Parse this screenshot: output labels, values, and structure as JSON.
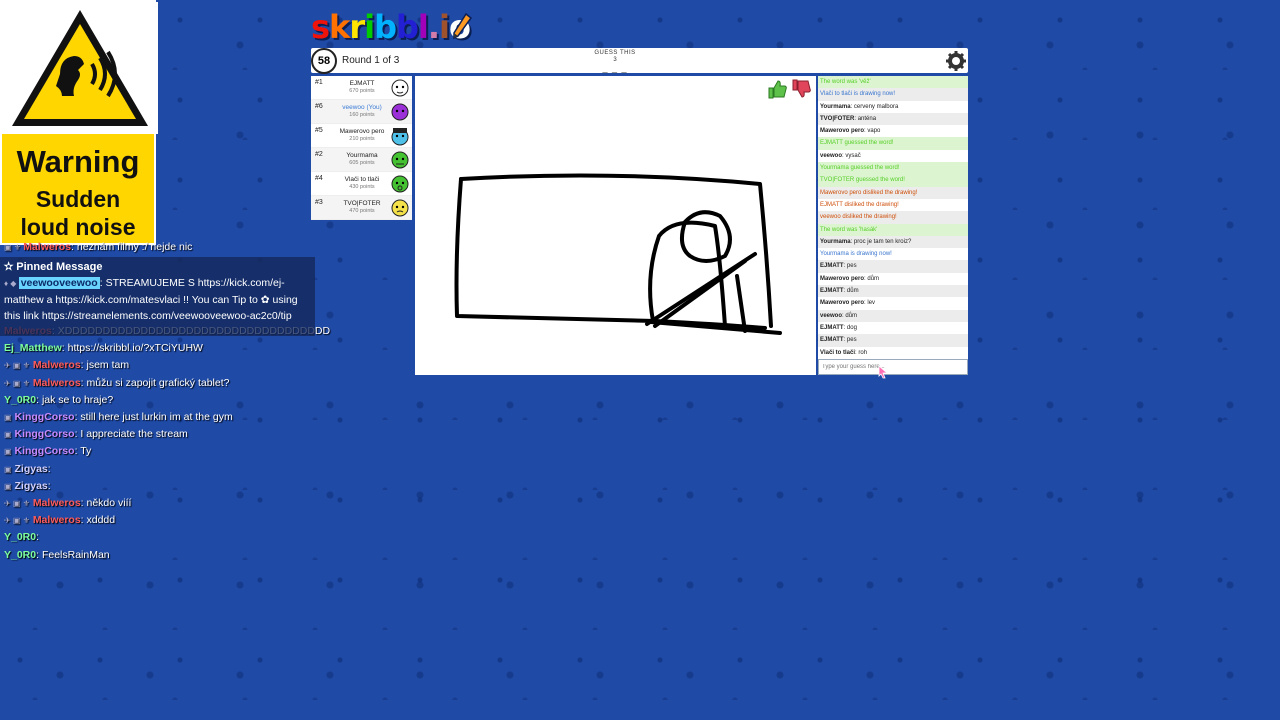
{
  "warning": {
    "title": "Warning",
    "subtitle_1": "Sudden",
    "subtitle_2": "loud noise"
  },
  "game": {
    "logo": "skribbl.io",
    "timer": "58",
    "round": "Round 1 of 3",
    "guess_label": "GUESS THIS",
    "guess_count": "3",
    "guess_blanks": "_ _ _",
    "input_placeholder": "Type your guess here..."
  },
  "players": [
    {
      "rank": "#1",
      "name": "EJMATT",
      "points": "670 points",
      "avatar_color": "#ffffff"
    },
    {
      "rank": "#6",
      "name": "veewoo (You)",
      "points": "160 points",
      "avatar_color": "#9b30d9"
    },
    {
      "rank": "#5",
      "name": "Mawerovo pero",
      "points": "210 points",
      "avatar_color": "#4fc0e8"
    },
    {
      "rank": "#2",
      "name": "Yourmama",
      "points": "605 points",
      "avatar_color": "#45c232"
    },
    {
      "rank": "#4",
      "name": "Vlači to tlači",
      "points": "430 points",
      "avatar_color": "#45c232"
    },
    {
      "rank": "#3",
      "name": "TVO|FOTER",
      "points": "470 points",
      "avatar_color": "#f5e24a"
    }
  ],
  "game_chat": [
    {
      "type": "green",
      "user": "",
      "text": "The word was 'věž'"
    },
    {
      "type": "blue",
      "user": "",
      "text": "Vlači to tlači is drawing now!"
    },
    {
      "type": "normal",
      "user": "Yourmama",
      "text": "cerveny malbora"
    },
    {
      "type": "normal",
      "user": "TVO|FOTER",
      "text": "anténa"
    },
    {
      "type": "normal",
      "user": "Mawerovo pero",
      "text": "vapo"
    },
    {
      "type": "green",
      "user": "",
      "text": "EJMATT guessed the word!"
    },
    {
      "type": "normal",
      "user": "veewoo",
      "text": "vysač"
    },
    {
      "type": "green",
      "user": "",
      "text": "Yourmama guessed the word!"
    },
    {
      "type": "green",
      "user": "",
      "text": "TVO|FOTER guessed the word!"
    },
    {
      "type": "red",
      "user": "",
      "text": "Mawerovo pero disliked the drawing!"
    },
    {
      "type": "red",
      "user": "",
      "text": "EJMATT disliked the drawing!"
    },
    {
      "type": "red",
      "user": "",
      "text": "veewoo disliked the drawing!"
    },
    {
      "type": "green",
      "user": "",
      "text": "The word was 'hasák'"
    },
    {
      "type": "normal",
      "user": "Yourmama",
      "text": "proc je tam ten kroiz?"
    },
    {
      "type": "blue",
      "user": "",
      "text": "Yourmama is drawing now!"
    },
    {
      "type": "normal",
      "user": "EJMATT",
      "text": "pes"
    },
    {
      "type": "normal",
      "user": "Mawerovo pero",
      "text": "dům"
    },
    {
      "type": "normal",
      "user": "EJMATT",
      "text": "dům"
    },
    {
      "type": "normal",
      "user": "Mawerovo pero",
      "text": "lev"
    },
    {
      "type": "normal",
      "user": "veewoo",
      "text": "dům"
    },
    {
      "type": "normal",
      "user": "EJMATT",
      "text": "dog"
    },
    {
      "type": "normal",
      "user": "EJMATT",
      "text": "pes"
    },
    {
      "type": "normal",
      "user": "Vlači to tlači",
      "text": "roh"
    }
  ],
  "stream_chat": {
    "top_partial": {
      "user": "Malweros",
      "text": ": neznám filmy :/ nejde nic"
    },
    "pinned": {
      "header": "Pinned Message",
      "user": "veewooveewoo",
      "line1": "STREAMUJEME S https://kick.com/ej-",
      "line2": "matthew a https://kick.com/matesvlaci !! You can Tip to",
      "line3": "using",
      "line4": "this link https://streamelements.com/veewooveewoo-ac2c0/tip"
    },
    "messages": [
      {
        "user": "Malweros",
        "color": "red",
        "text": ": XDDDDDDDDDDDDDDDDDDDDDDDDDDDDDDDDDDD",
        "icons": ""
      },
      {
        "user": "Ej_Matthew",
        "color": "green",
        "text": ": https://skribbl.io/?xTCiYUHW",
        "icons": ""
      },
      {
        "user": "Malweros",
        "color": "red",
        "text": ": jsem tam",
        "icons": "✈ ▣ ⚜"
      },
      {
        "user": "Malweros",
        "color": "red",
        "text": ": můžu si zapojit grafický tablet?",
        "icons": "✈ ▣ ⚜"
      },
      {
        "user": "Y_0R0",
        "color": "green",
        "text": ": jak se to hraje?",
        "icons": ""
      },
      {
        "user": "KinggCorso",
        "color": "purple",
        "text": ": still here just lurkin im at the gym",
        "icons": "▣"
      },
      {
        "user": "KinggCorso",
        "color": "purple",
        "text": ": I appreciate the stream",
        "icons": "▣"
      },
      {
        "user": "KinggCorso",
        "color": "purple",
        "text": ": Ty",
        "icons": "▣"
      },
      {
        "user": "Zigyas",
        "color": "gray",
        "text": ":",
        "icons": "▣"
      },
      {
        "user": "Zigyas",
        "color": "gray",
        "text": ":",
        "icons": "▣"
      },
      {
        "user": "Malweros",
        "color": "red",
        "text": ": někdo viíí",
        "icons": "✈ ▣ ⚜"
      },
      {
        "user": "Malweros",
        "color": "red",
        "text": ": xdddd",
        "icons": "✈ ▣ ⚜"
      },
      {
        "user": "Y_0R0",
        "color": "green",
        "text": ":",
        "icons": ""
      },
      {
        "user": "Y_0R0",
        "color": "green",
        "text": ": FeelsRainMan",
        "icons": ""
      }
    ]
  }
}
